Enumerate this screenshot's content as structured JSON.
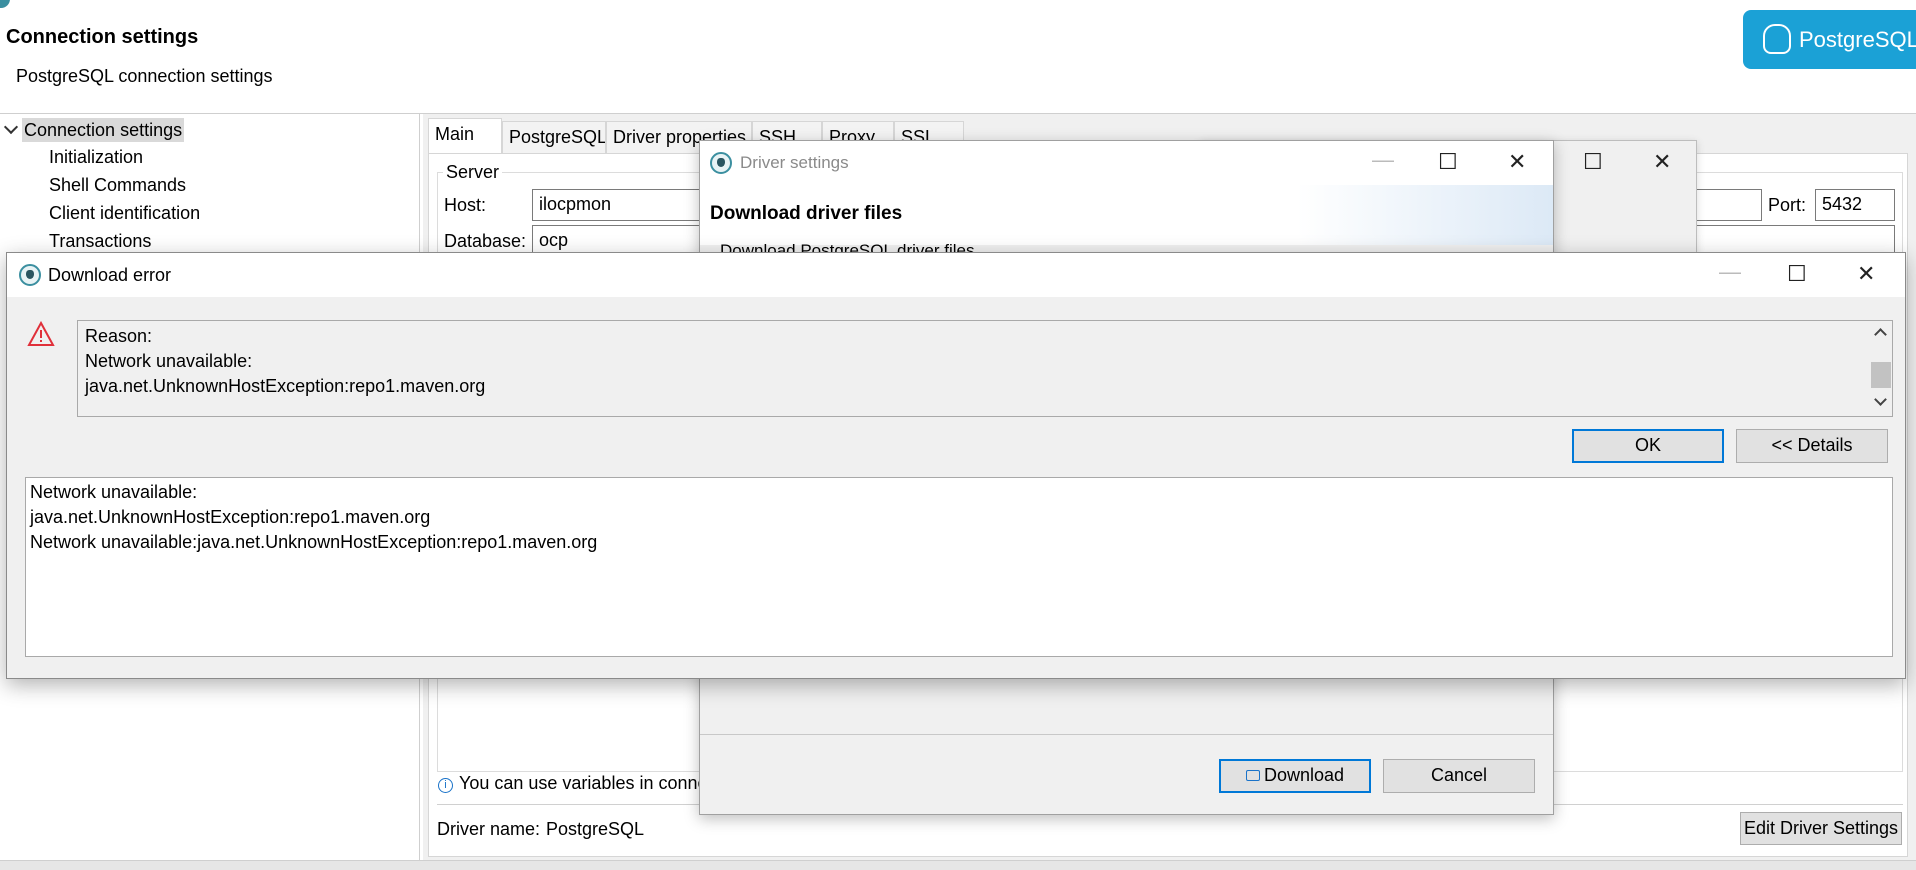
{
  "header": {
    "title": "Connection settings",
    "subtitle": "PostgreSQL connection settings",
    "logo_text": "PostgreSQL"
  },
  "nav_tree": {
    "root": "Connection settings",
    "items": [
      "Initialization",
      "Shell Commands",
      "Client identification",
      "Transactions"
    ]
  },
  "tabs": [
    "Main",
    "PostgreSQL",
    "Driver properties",
    "SSH",
    "Proxy",
    "SSL"
  ],
  "main_form": {
    "server_group": "Server",
    "host_label": "Host:",
    "host_value": "ilocpmon",
    "port_label": "Port:",
    "port_value": "5432",
    "database_label": "Database:",
    "database_value": "ocp",
    "variables_hint": "You can use variables in conne",
    "driver_name_label": "Driver name:",
    "driver_name_value": "PostgreSQL",
    "edit_driver_button": "Edit Driver Settings"
  },
  "driver_dialog": {
    "title": "Driver settings",
    "heading": "Download driver files",
    "subheading": "Download PostgreSQL driver files",
    "download_button": "Download",
    "cancel_button": "Cancel"
  },
  "error_dialog": {
    "title": "Download error",
    "reason_lines": [
      "Reason:",
      "Network unavailable:",
      "java.net.UnknownHostException:repo1.maven.org"
    ],
    "ok_button": "OK",
    "details_button": "<< Details",
    "details_lines": [
      "Network unavailable:",
      "java.net.UnknownHostException:repo1.maven.org",
      "Network unavailable:java.net.UnknownHostException:repo1.maven.org"
    ]
  },
  "colors": {
    "accent": "#0078d7",
    "logo_bg": "#1ba1d6",
    "error_icon": "#e0303a",
    "info_icon": "#1a73c9"
  }
}
